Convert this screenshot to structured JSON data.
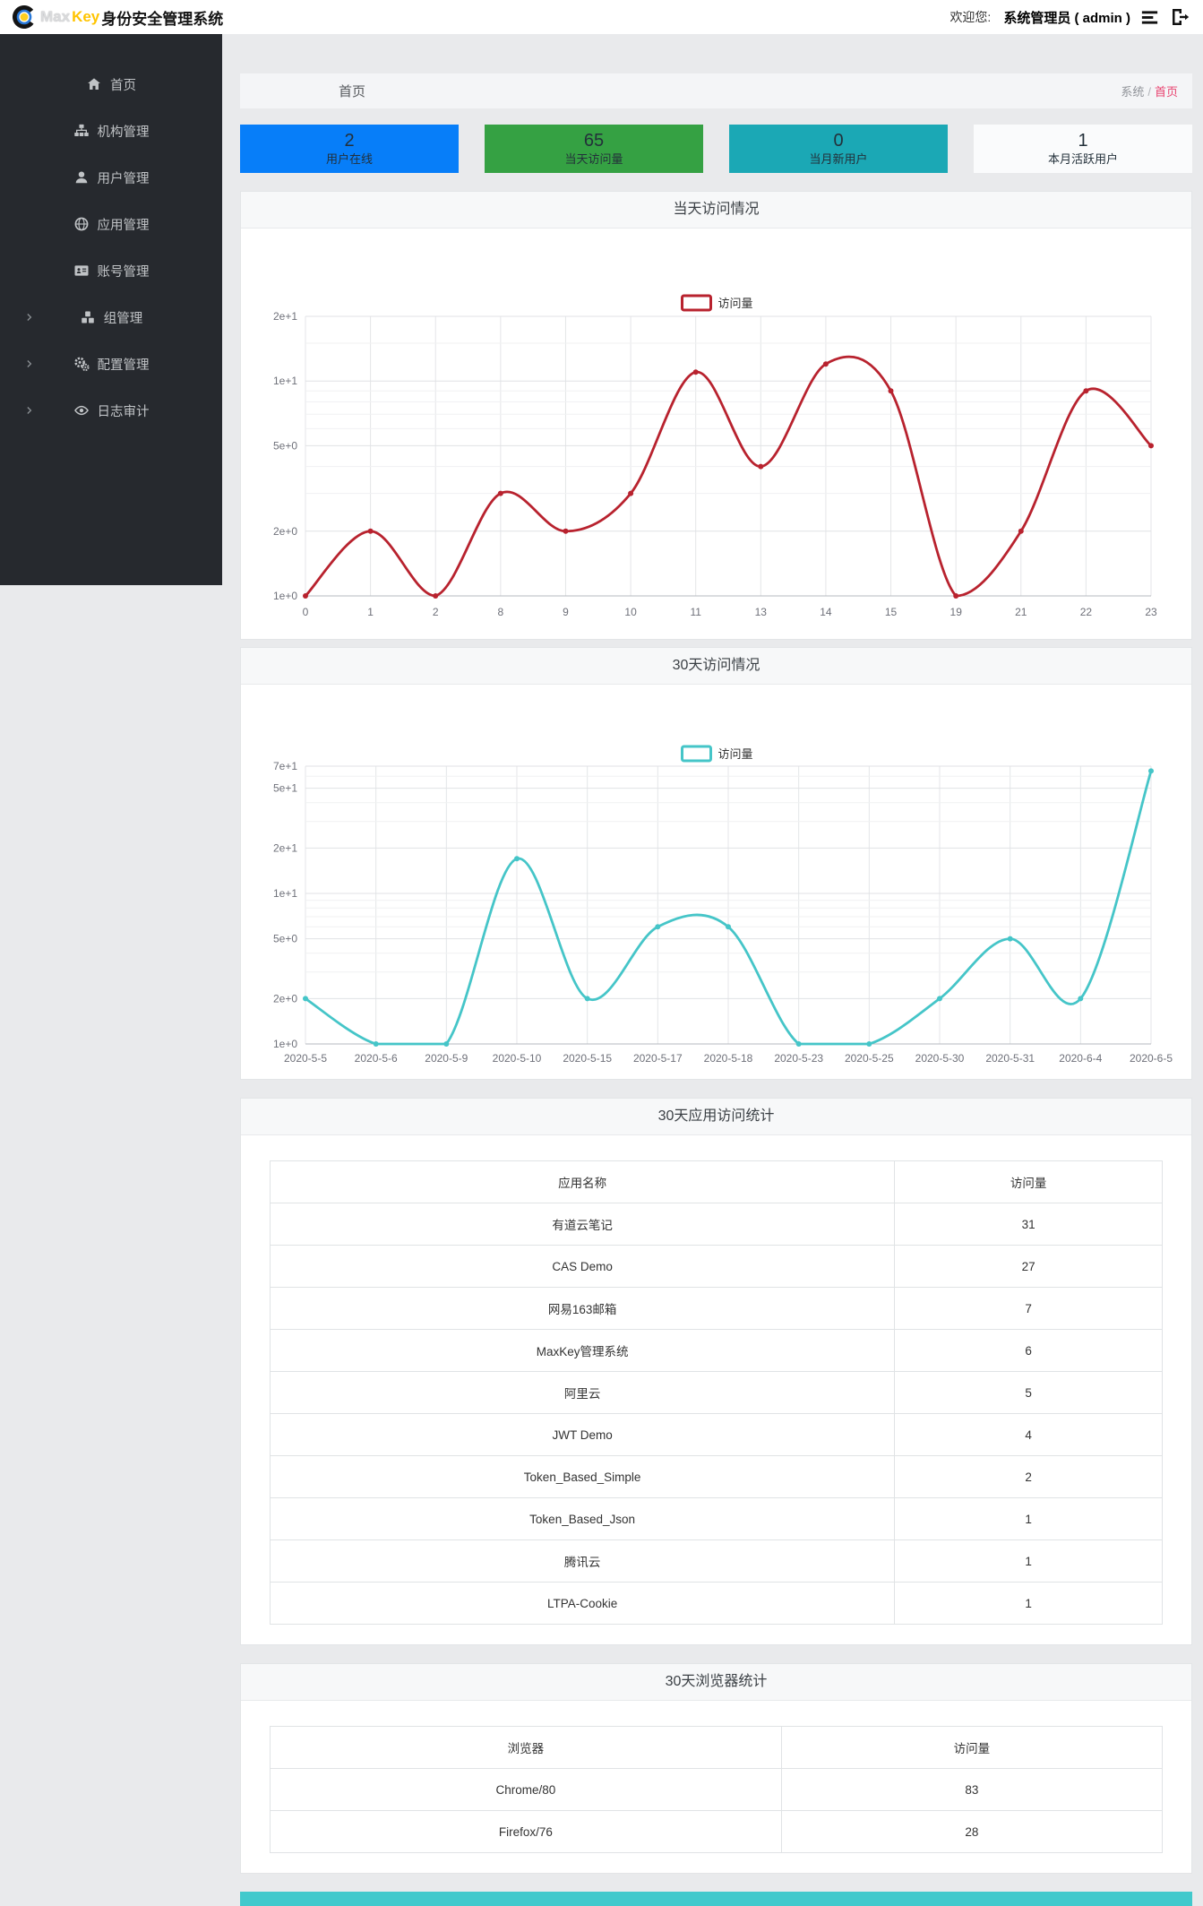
{
  "header": {
    "brand_max": "Max",
    "brand_key": "Key",
    "brand_suffix": "身份安全管理系统",
    "welcome_label": "欢迎您:",
    "user_name": "系统管理员 ( admin )"
  },
  "sidebar": {
    "items": [
      {
        "name": "home",
        "label": "首页",
        "icon": "home-icon",
        "has_submenu": false
      },
      {
        "name": "org",
        "label": "机构管理",
        "icon": "sitemap-icon",
        "has_submenu": false
      },
      {
        "name": "users",
        "label": "用户管理",
        "icon": "user-icon",
        "has_submenu": false
      },
      {
        "name": "apps",
        "label": "应用管理",
        "icon": "globe-icon",
        "has_submenu": false
      },
      {
        "name": "accounts",
        "label": "账号管理",
        "icon": "id-card-icon",
        "has_submenu": false
      },
      {
        "name": "groups",
        "label": "组管理",
        "icon": "cubes-icon",
        "has_submenu": true
      },
      {
        "name": "config",
        "label": "配置管理",
        "icon": "gears-icon",
        "has_submenu": true
      },
      {
        "name": "audit",
        "label": "日志审计",
        "icon": "eye-icon",
        "has_submenu": true
      }
    ]
  },
  "page": {
    "title": "首页",
    "breadcrumb_section": "系统",
    "breadcrumb_sep": "/",
    "breadcrumb_current": "首页",
    "breadcrumb_current_color": "#e8426f"
  },
  "stats": [
    {
      "name": "online-users",
      "value": "2",
      "label": "用户在线",
      "color": "#077ef9"
    },
    {
      "name": "today-visits",
      "value": "65",
      "label": "当天访问量",
      "color": "#35a143"
    },
    {
      "name": "month-new-users",
      "value": "0",
      "label": "当月新用户",
      "color": "#1ba8b5"
    },
    {
      "name": "month-active-users",
      "value": "1",
      "label": "本月活跃用户",
      "color": "#fafbfc"
    }
  ],
  "chart_data": [
    {
      "id": "today_visits",
      "type": "line",
      "panel_title": "当天访问情况",
      "legend": "访问量",
      "color": "#b8222e",
      "y_scale": "log",
      "ylim": [
        1,
        20
      ],
      "grid": true,
      "legend_position": "top-center",
      "categories": [
        "0",
        "1",
        "2",
        "8",
        "9",
        "10",
        "11",
        "13",
        "14",
        "15",
        "19",
        "21",
        "22",
        "23"
      ],
      "values": [
        1,
        2,
        1,
        3,
        2,
        3,
        11,
        4,
        12,
        9,
        1,
        2,
        9,
        5
      ],
      "y_ticks": [
        {
          "label": "2e+1",
          "value": 20
        },
        {
          "label": "1e+1",
          "value": 10
        },
        {
          "label": "5e+0",
          "value": 5
        },
        {
          "label": "2e+0",
          "value": 2
        },
        {
          "label": "1e+0",
          "value": 1
        }
      ],
      "minor_ticks": [
        15,
        9,
        8,
        7,
        6,
        4,
        3
      ]
    },
    {
      "id": "month_visits",
      "type": "line",
      "panel_title": "30天访问情况",
      "legend": "访问量",
      "color": "#45c5c8",
      "y_scale": "log",
      "ylim": [
        1,
        70
      ],
      "grid": true,
      "legend_position": "top-center",
      "categories": [
        "2020-5-5",
        "2020-5-6",
        "2020-5-9",
        "2020-5-10",
        "2020-5-15",
        "2020-5-17",
        "2020-5-18",
        "2020-5-23",
        "2020-5-25",
        "2020-5-30",
        "2020-5-31",
        "2020-6-4",
        "2020-6-5"
      ],
      "values": [
        2,
        1,
        1,
        17,
        2,
        6,
        6,
        1,
        1,
        2,
        5,
        2,
        65
      ],
      "y_ticks": [
        {
          "label": "7e+1",
          "value": 70
        },
        {
          "label": "5e+1",
          "value": 50
        },
        {
          "label": "2e+1",
          "value": 20
        },
        {
          "label": "1e+1",
          "value": 10
        },
        {
          "label": "5e+0",
          "value": 5
        },
        {
          "label": "2e+0",
          "value": 2
        },
        {
          "label": "1e+0",
          "value": 1
        }
      ],
      "minor_ticks": [
        60,
        40,
        30,
        9,
        8,
        7,
        6,
        4,
        3
      ]
    }
  ],
  "tables": {
    "apps": {
      "title": "30天应用访问统计",
      "headers": [
        "应用名称",
        "访问量"
      ],
      "rows": [
        [
          "有道云笔记",
          "31"
        ],
        [
          "CAS Demo",
          "27"
        ],
        [
          "网易163邮箱",
          "7"
        ],
        [
          "MaxKey管理系统",
          "6"
        ],
        [
          "阿里云",
          "5"
        ],
        [
          "JWT Demo",
          "4"
        ],
        [
          "Token_Based_Simple",
          "2"
        ],
        [
          "Token_Based_Json",
          "1"
        ],
        [
          "腾讯云",
          "1"
        ],
        [
          "LTPA-Cookie",
          "1"
        ]
      ]
    },
    "browsers": {
      "title": "30天浏览器统计",
      "headers": [
        "浏览器",
        "访问量"
      ],
      "rows": [
        [
          "Chrome/80",
          "83"
        ],
        [
          "Firefox/76",
          "28"
        ]
      ]
    }
  },
  "footer": {
    "bar_color": "#41c9cc"
  }
}
